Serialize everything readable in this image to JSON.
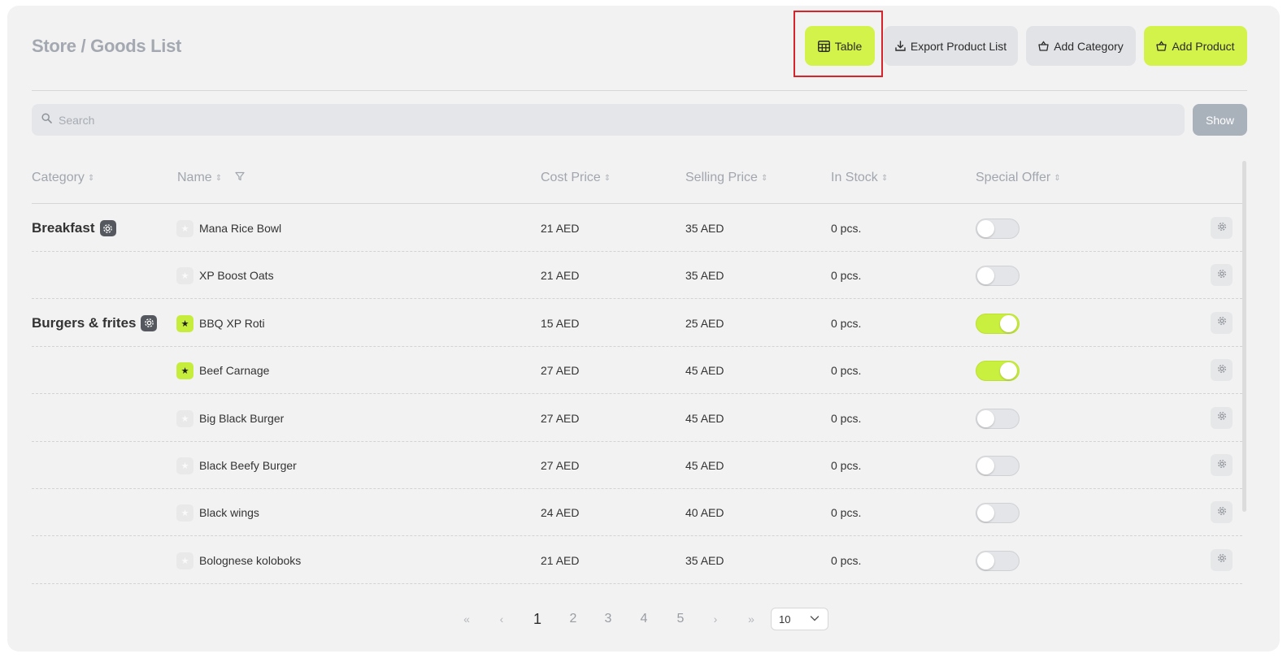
{
  "header": {
    "title": "Store / Goods List",
    "buttons": {
      "table": "Table",
      "export": "Export Product List",
      "add_category": "Add Category",
      "add_product": "Add Product"
    }
  },
  "search": {
    "placeholder": "Search",
    "show_label": "Show"
  },
  "columns": {
    "category": "Category",
    "name": "Name",
    "cost_price": "Cost Price",
    "selling_price": "Selling Price",
    "in_stock": "In Stock",
    "special_offer": "Special Offer"
  },
  "rows": [
    {
      "category": "Breakfast",
      "name": "Mana Rice Bowl",
      "cost": "21 AED",
      "price": "35 AED",
      "stock": "0 pcs.",
      "featured": false,
      "special_offer": false
    },
    {
      "category": "",
      "name": "XP Boost Oats",
      "cost": "21 AED",
      "price": "35 AED",
      "stock": "0 pcs.",
      "featured": false,
      "special_offer": false
    },
    {
      "category": "Burgers & frites",
      "name": "BBQ XP Roti",
      "cost": "15 AED",
      "price": "25 AED",
      "stock": "0 pcs.",
      "featured": true,
      "special_offer": true
    },
    {
      "category": "",
      "name": "Beef Carnage",
      "cost": "27 AED",
      "price": "45 AED",
      "stock": "0 pcs.",
      "featured": true,
      "special_offer": true
    },
    {
      "category": "",
      "name": "Big Black Burger",
      "cost": "27 AED",
      "price": "45 AED",
      "stock": "0 pcs.",
      "featured": false,
      "special_offer": false
    },
    {
      "category": "",
      "name": "Black Beefy Burger",
      "cost": "27 AED",
      "price": "45 AED",
      "stock": "0 pcs.",
      "featured": false,
      "special_offer": false
    },
    {
      "category": "",
      "name": "Black wings",
      "cost": "24 AED",
      "price": "40 AED",
      "stock": "0 pcs.",
      "featured": false,
      "special_offer": false
    },
    {
      "category": "",
      "name": "Bolognese koloboks",
      "cost": "21 AED",
      "price": "35 AED",
      "stock": "0 pcs.",
      "featured": false,
      "special_offer": false
    }
  ],
  "pagination": {
    "first": "«",
    "prev": "‹",
    "pages": [
      "1",
      "2",
      "3",
      "4",
      "5"
    ],
    "current": "1",
    "next": "›",
    "last": "»",
    "per_page": "10"
  },
  "colors": {
    "accent": "#d3f24a",
    "highlight": "#d8232a"
  }
}
